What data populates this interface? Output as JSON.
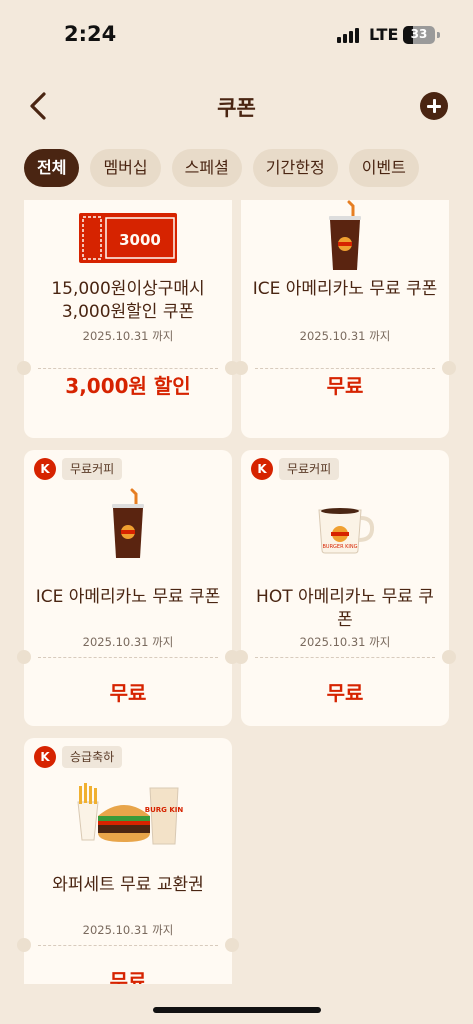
{
  "status_bar": {
    "time": "2:24",
    "network": "LTE",
    "battery": "33"
  },
  "header": {
    "title": "쿠폰"
  },
  "tabs": [
    {
      "label": "전체",
      "active": true
    },
    {
      "label": "멤버십",
      "active": false
    },
    {
      "label": "스페셜",
      "active": false
    },
    {
      "label": "기간한정",
      "active": false
    },
    {
      "label": "이벤트",
      "active": false
    }
  ],
  "coupons": [
    {
      "badge": "",
      "tag": "",
      "name": "15,000원이상구매시 3,000원할인 쿠폰",
      "date": "2025.10.31 까지",
      "value": "3,000원 할인",
      "image": "voucher-3000",
      "image_text": "3000"
    },
    {
      "badge": "",
      "tag": "",
      "name": "ICE 아메리카노 무료 쿠폰",
      "date": "2025.10.31 까지",
      "value": "무료",
      "image": "iced-americano"
    },
    {
      "badge": "K",
      "tag": "무료커피",
      "name": "ICE 아메리카노 무료 쿠폰",
      "date": "2025.10.31 까지",
      "value": "무료",
      "image": "iced-americano"
    },
    {
      "badge": "K",
      "tag": "무료커피",
      "name": "HOT 아메리카노 무료 쿠폰",
      "date": "2025.10.31 까지",
      "value": "무료",
      "image": "hot-americano",
      "image_text": "BURGER KING"
    },
    {
      "badge": "K",
      "tag": "승급축하",
      "name": "와퍼세트 무료 교환권",
      "date": "2025.10.31 까지",
      "value": "무료",
      "image": "whopper-set",
      "image_text": "BURG KIN"
    }
  ],
  "colors": {
    "background": "#f3e9dc",
    "brown": "#4a2512",
    "red": "#d62300",
    "card": "#fffaf3"
  }
}
